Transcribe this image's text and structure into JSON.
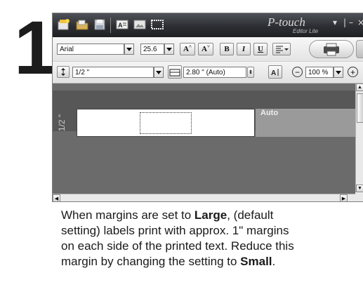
{
  "step": {
    "number": "1"
  },
  "app": {
    "brand": "P-touch",
    "brand_sub": "Editor Lite"
  },
  "toolbar1": {
    "font_name": "Arial",
    "font_size": "25.6",
    "grow_font_label": "A",
    "shrink_font_label": "A",
    "bold_label": "B",
    "italic_label": "I",
    "underline_label": "U"
  },
  "toolbar2": {
    "tape_width": "1/2 \"",
    "label_length": "2.80 \" (Auto)",
    "zoom": "100 %"
  },
  "canvas": {
    "tape_width_label": "1/2 \"",
    "length_mode": "Auto"
  },
  "caption": {
    "line1_pre": "When margins are set to ",
    "line1_bold": "Large",
    "line1_post": ", (default",
    "line2": "setting) labels print with approx. 1\" margins",
    "line3": "on each side of the printed text. Reduce this",
    "line4_pre": "margin by changing the setting to ",
    "line4_bold": "Small",
    "line4_post": "."
  },
  "colors": {
    "titlebar": "#2c2e33",
    "canvas": "#6b6b6b",
    "paper": "#ffffff"
  }
}
